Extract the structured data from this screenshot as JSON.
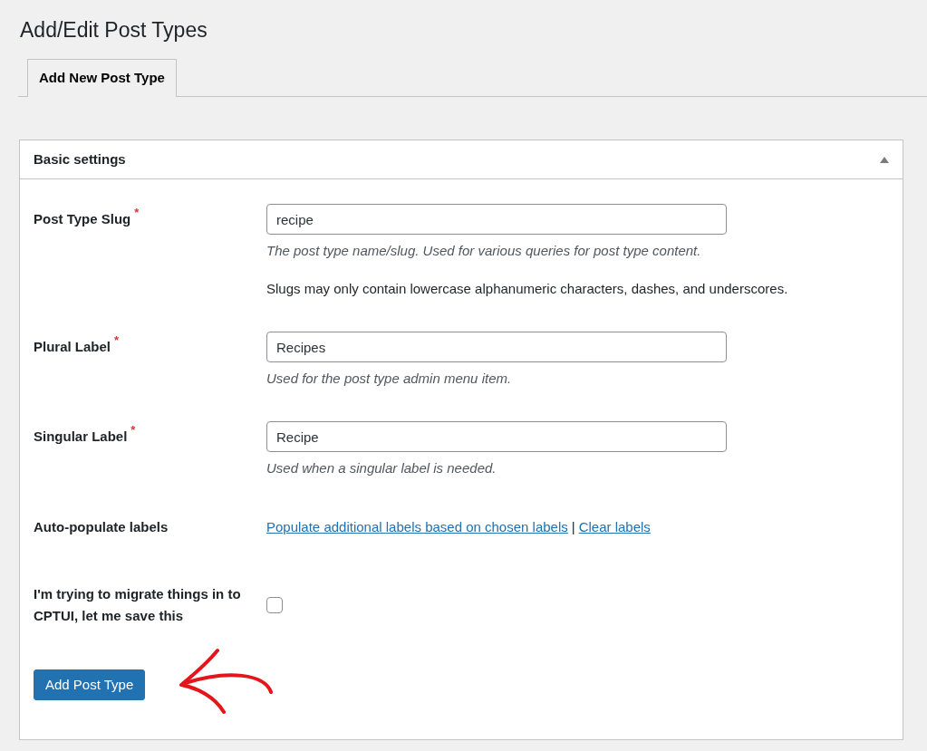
{
  "page_title": "Add/Edit Post Types",
  "tabs": [
    {
      "label": "Add New Post Type",
      "selected": true
    }
  ],
  "panel": {
    "title": "Basic settings",
    "expanded": true,
    "required_mark": "*",
    "fields": [
      {
        "kind": "text",
        "label": "Post Type Slug",
        "required": true,
        "value": "recipe",
        "description": "The post type name/slug. Used for various queries for post type content.",
        "note": "Slugs may only contain lowercase alphanumeric characters, dashes, and underscores."
      },
      {
        "kind": "text",
        "label": "Plural Label",
        "required": true,
        "value": "Recipes",
        "description": "Used for the post type admin menu item."
      },
      {
        "kind": "text",
        "label": "Singular Label",
        "required": true,
        "value": "Recipe",
        "description": "Used when a singular label is needed."
      },
      {
        "kind": "links",
        "label": "Auto-populate labels",
        "links": [
          "Populate additional labels based on chosen labels",
          "Clear labels"
        ],
        "separator": "|"
      },
      {
        "kind": "checkbox",
        "label": "I'm trying to migrate things in to CPTUI, let me save this",
        "checked": false
      }
    ],
    "submit": "Add Post Type"
  }
}
